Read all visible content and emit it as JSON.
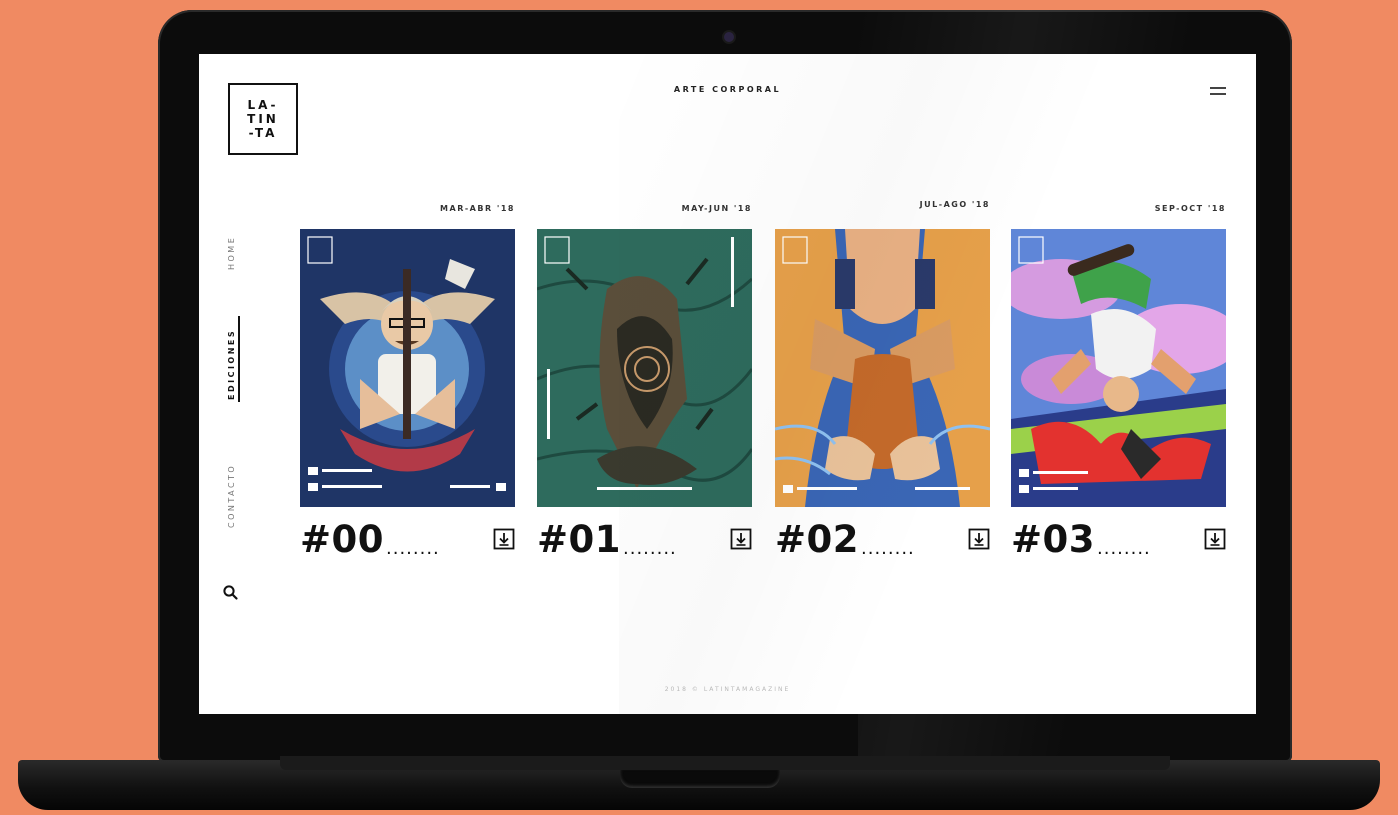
{
  "app": {
    "logo_lines": [
      "LA-",
      "TIN",
      "-TA"
    ],
    "page_title": "ARTE CORPORAL"
  },
  "nav": {
    "home": "HOME",
    "ediciones": "EDICIONES",
    "contacto": "CONTACTO"
  },
  "icons": {
    "menu": "hamburger-icon",
    "search": "search-icon",
    "download": "download-icon"
  },
  "issues": [
    {
      "number": "#00",
      "date": "MAR-ABR '18",
      "dots": "........",
      "bg": "#1F3566"
    },
    {
      "number": "#01",
      "date": "MAY-JUN '18",
      "dots": "........",
      "bg": "#2E6B5D"
    },
    {
      "number": "#02",
      "date": "JUL-AGO '18",
      "dots": "........",
      "bg": "#3A66B5"
    },
    {
      "number": "#03",
      "date": "SEP-OCT '18",
      "dots": "........",
      "bg": "#5F86D8"
    }
  ],
  "footer": "2018 © LATINTAMAGAZINE",
  "colors": {
    "background": "#F08A62",
    "screen": "#FFFFFF",
    "text": "#111111"
  }
}
